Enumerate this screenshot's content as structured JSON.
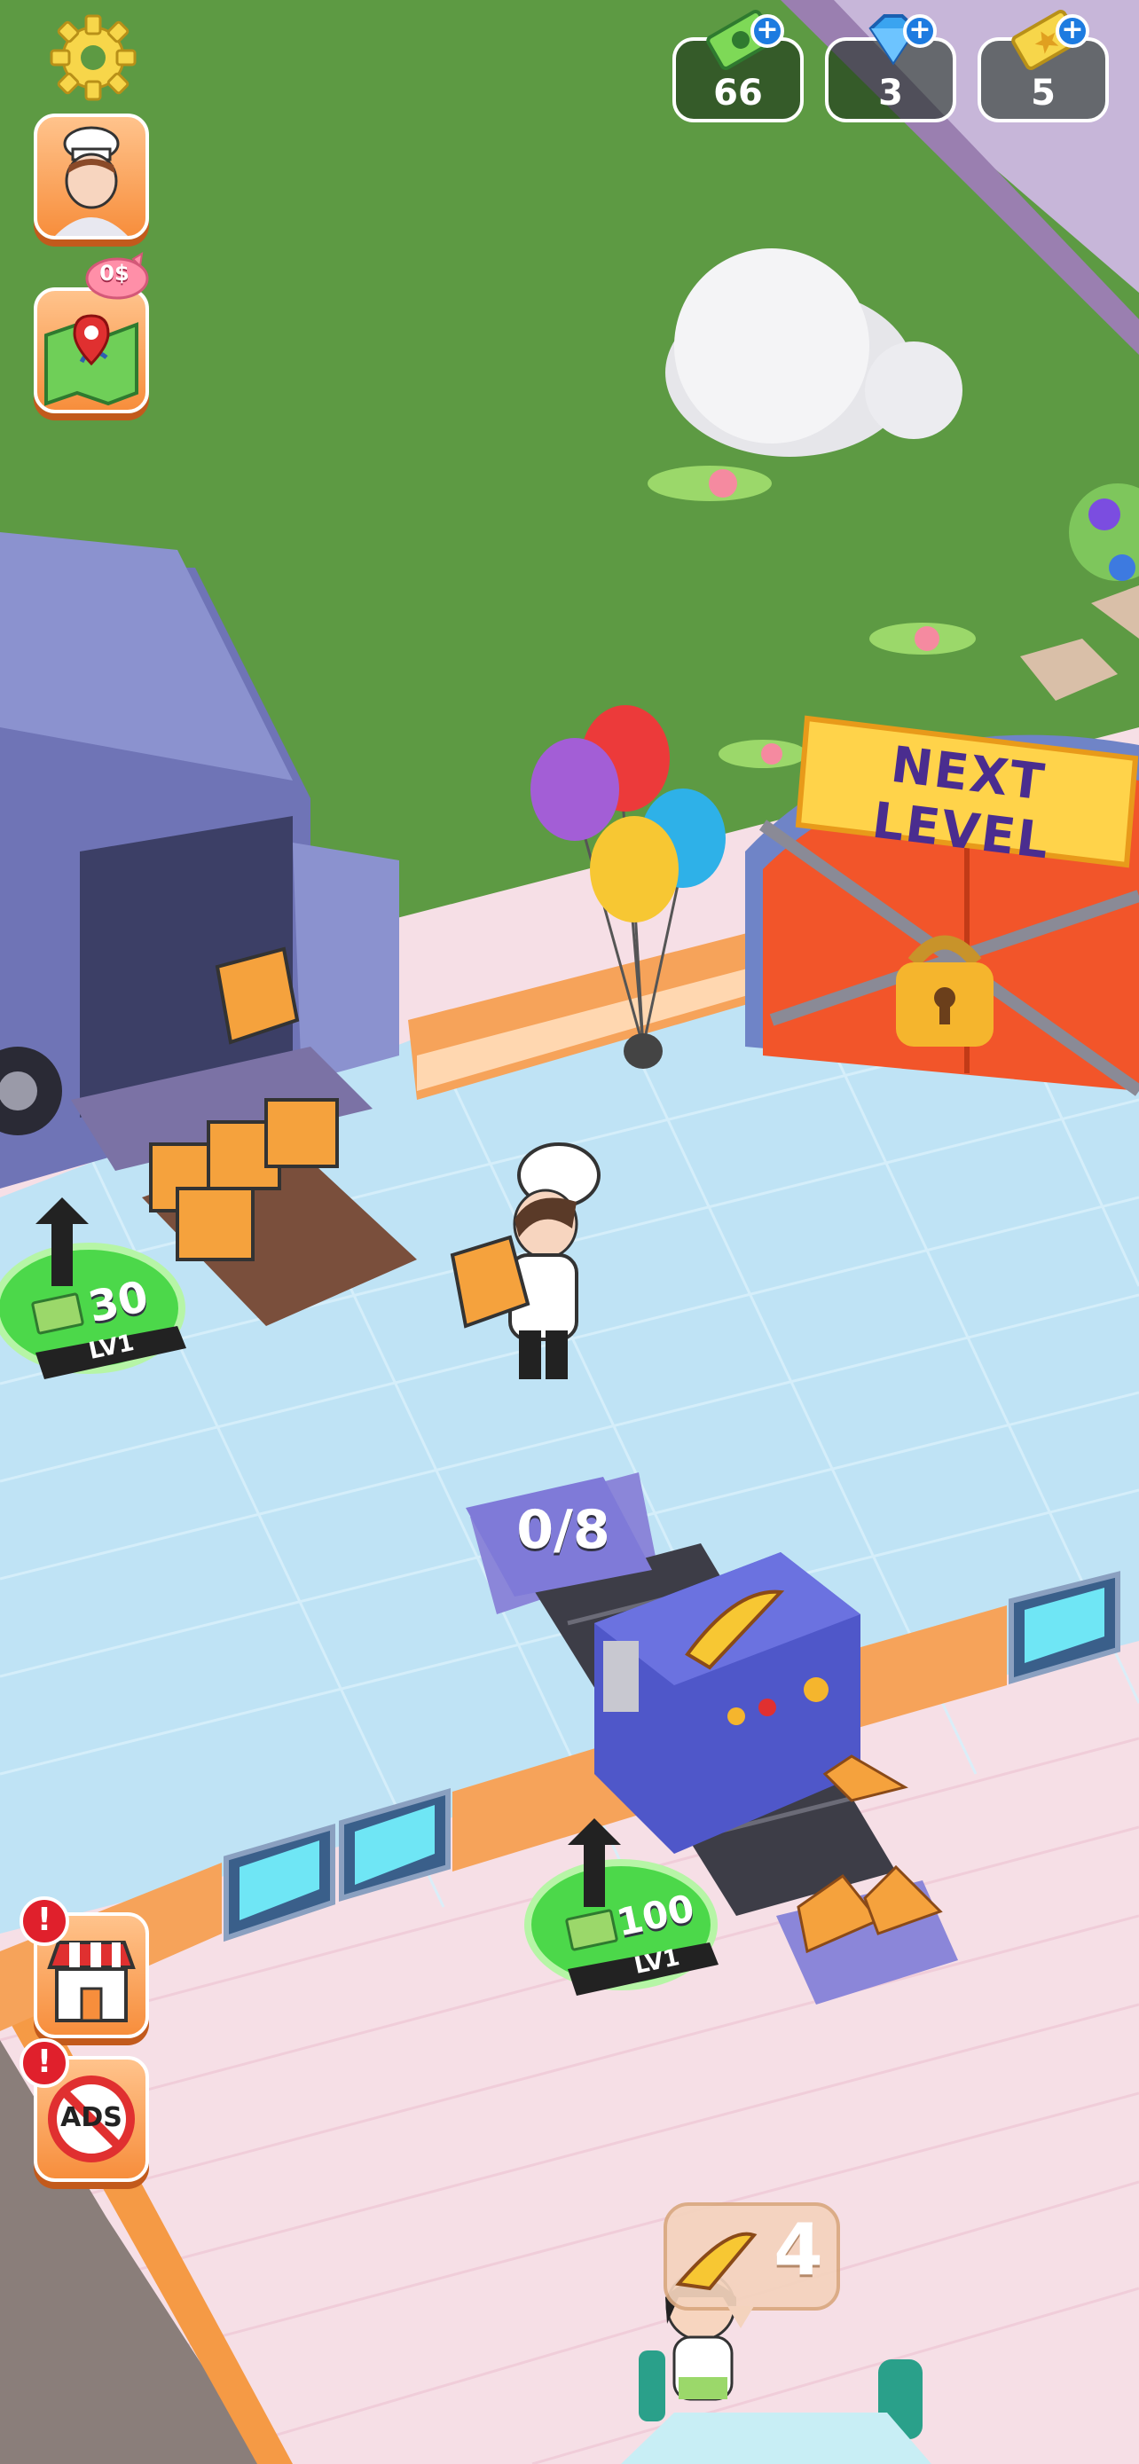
{
  "hud": {
    "cash": "66",
    "gems": "3",
    "tickets": "5",
    "piggy_bank": "0$"
  },
  "scene": {
    "gate_label": "NEXT LEVEL",
    "delivery_station": {
      "cost": "30",
      "level": "LV1"
    },
    "pizza_oven": {
      "cost": "100",
      "level": "LV1",
      "capacity": "0/8"
    },
    "customer_order": {
      "count": "4"
    }
  },
  "side_buttons": {
    "shop_alert": "!",
    "ads_label": "ADS",
    "ads_alert": "!"
  },
  "colors": {
    "grass": "#5d9a43",
    "floor_blue": "#bfe3f5",
    "floor_pink": "#f9e2ea",
    "button_orange": "#f79a4c",
    "currency_blue": "#1d7be0",
    "gate_red": "#f2552a",
    "sign_yellow": "#ffd34a",
    "upgrade_green": "#4cd84a"
  }
}
